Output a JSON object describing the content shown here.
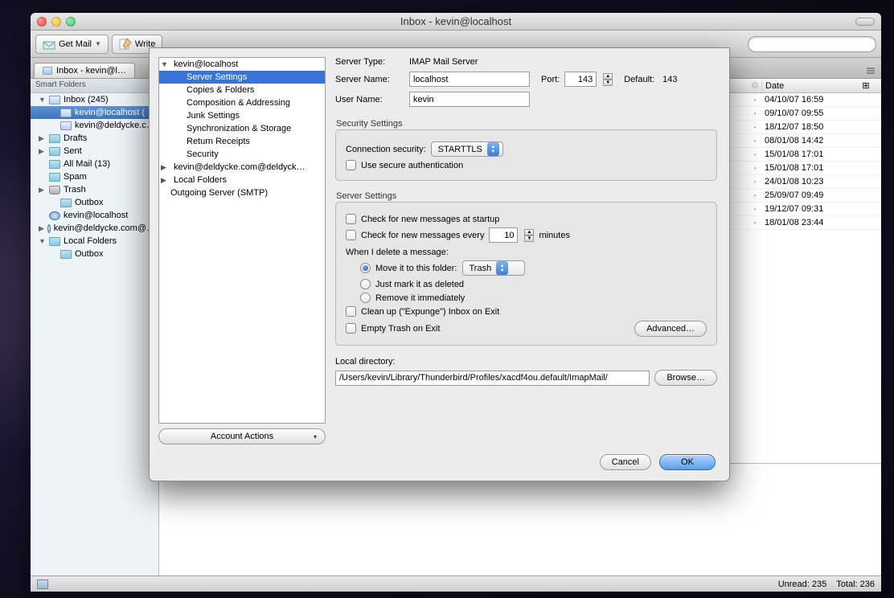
{
  "window": {
    "title": "Inbox - kevin@localhost"
  },
  "toolbar": {
    "getmail": "Get Mail",
    "write": "Write"
  },
  "tab": {
    "label": "Inbox - kevin@l…"
  },
  "sidebar": {
    "header": "Smart Folders",
    "items": [
      {
        "label": "Inbox (245)",
        "type": "inbox",
        "disclosure": "▼"
      },
      {
        "label": "kevin@localhost (",
        "type": "inbox",
        "lvl": 1,
        "selected": true
      },
      {
        "label": "kevin@deldycke.c…",
        "type": "inbox",
        "lvl": 1
      },
      {
        "label": "Drafts",
        "type": "folder",
        "disclosure": "▶"
      },
      {
        "label": "Sent",
        "type": "folder",
        "disclosure": "▶"
      },
      {
        "label": "All Mail (13)",
        "type": "folder"
      },
      {
        "label": "Spam",
        "type": "folder"
      },
      {
        "label": "Trash",
        "type": "trash",
        "disclosure": "▶"
      },
      {
        "label": "Outbox",
        "type": "folder",
        "lvl": 1
      },
      {
        "label": "kevin@localhost",
        "type": "globe"
      },
      {
        "label": "kevin@deldycke.com@…",
        "type": "globe",
        "disclosure": "▶"
      },
      {
        "label": "Local Folders",
        "type": "folder",
        "disclosure": "▼"
      },
      {
        "label": "Outbox",
        "type": "folder",
        "lvl": 1
      }
    ]
  },
  "messages": {
    "col_date": "Date",
    "rows": [
      "04/10/07 16:59",
      "09/10/07 09:55",
      "18/12/07 18:50",
      "08/01/08 14:42",
      "15/01/08 17:01",
      "15/01/08 17:01",
      "24/01/08 10:23",
      "25/09/07 09:49",
      "19/12/07 09:31",
      "18/01/08 23:44"
    ]
  },
  "statusbar": {
    "unread_label": "Unread:",
    "unread": "235",
    "total_label": "Total:",
    "total": "236"
  },
  "dialog": {
    "tree": [
      {
        "label": "kevin@localhost",
        "disclosure": "▼"
      },
      {
        "label": "Server Settings",
        "lvl": 1,
        "selected": true
      },
      {
        "label": "Copies & Folders",
        "lvl": 1
      },
      {
        "label": "Composition & Addressing",
        "lvl": 1
      },
      {
        "label": "Junk Settings",
        "lvl": 1
      },
      {
        "label": "Synchronization & Storage",
        "lvl": 1
      },
      {
        "label": "Return Receipts",
        "lvl": 1
      },
      {
        "label": "Security",
        "lvl": 1
      },
      {
        "label": "kevin@deldycke.com@deldyck…",
        "disclosure": "▶"
      },
      {
        "label": "Local Folders",
        "disclosure": "▶"
      },
      {
        "label": "Outgoing Server (SMTP)"
      }
    ],
    "account_actions": "Account Actions",
    "server_type_label": "Server Type:",
    "server_type": "IMAP Mail Server",
    "server_name_label": "Server Name:",
    "server_name": "localhost",
    "port_label": "Port:",
    "port": "143",
    "default_label": "Default:",
    "default_port": "143",
    "user_name_label": "User Name:",
    "user_name": "kevin",
    "security_title": "Security Settings",
    "conn_sec_label": "Connection security:",
    "conn_sec_value": "STARTTLS",
    "use_secure_auth": "Use secure authentication",
    "server_settings_title": "Server Settings",
    "check_startup": "Check for new messages at startup",
    "check_every_a": "Check for new messages every",
    "check_every_val": "10",
    "check_every_b": "minutes",
    "when_delete": "When I delete a message:",
    "move_to_folder": "Move it to this folder:",
    "trash_folder": "Trash",
    "just_mark": "Just mark it as deleted",
    "remove_immediately": "Remove it immediately",
    "expunge": "Clean up (\"Expunge\") Inbox on Exit",
    "empty_trash": "Empty Trash on Exit",
    "advanced": "Advanced…",
    "local_dir_label": "Local directory:",
    "local_dir": "/Users/kevin/Library/Thunderbird/Profiles/xacdf4ou.default/ImapMail/",
    "browse": "Browse…",
    "cancel": "Cancel",
    "ok": "OK"
  }
}
